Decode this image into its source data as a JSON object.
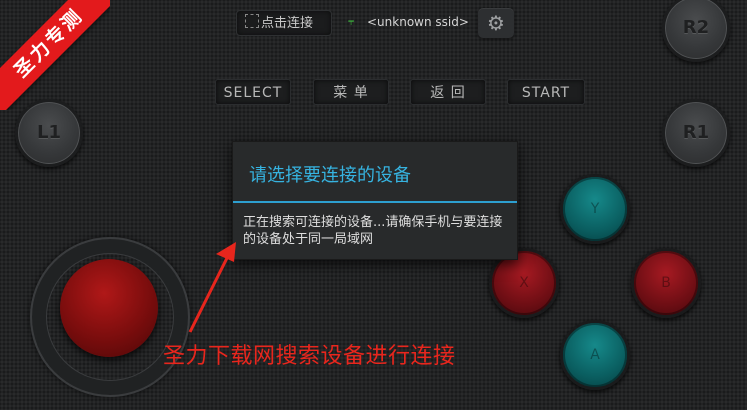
{
  "topbar": {
    "connect_label": "点击连接",
    "wifi_icon": "wifi-icon",
    "ssid": "<unknown ssid>",
    "settings_icon": "gear-icon"
  },
  "controls": {
    "select": "SELECT",
    "menu": "菜  单",
    "back": "返  回",
    "start": "START"
  },
  "shoulders": {
    "l1": "L1",
    "r1": "R1",
    "r2": "R2"
  },
  "face_buttons": {
    "top": "Y",
    "left": "X",
    "right": "B",
    "bottom": "A"
  },
  "dialog": {
    "title": "请选择要连接的设备",
    "message": "正在搜索可连接的设备...请确保手机与要连接的设备处于同一局域网"
  },
  "annotation": {
    "text": "圣力下载网搜索设备进行连接"
  },
  "ribbon": {
    "text": "圣力专测"
  },
  "colors": {
    "accent": "#36b3e0",
    "annotation": "#e8261d",
    "joystick": "#9c1515",
    "teal_button": "#0e6e70",
    "red_button": "#8c141b"
  }
}
